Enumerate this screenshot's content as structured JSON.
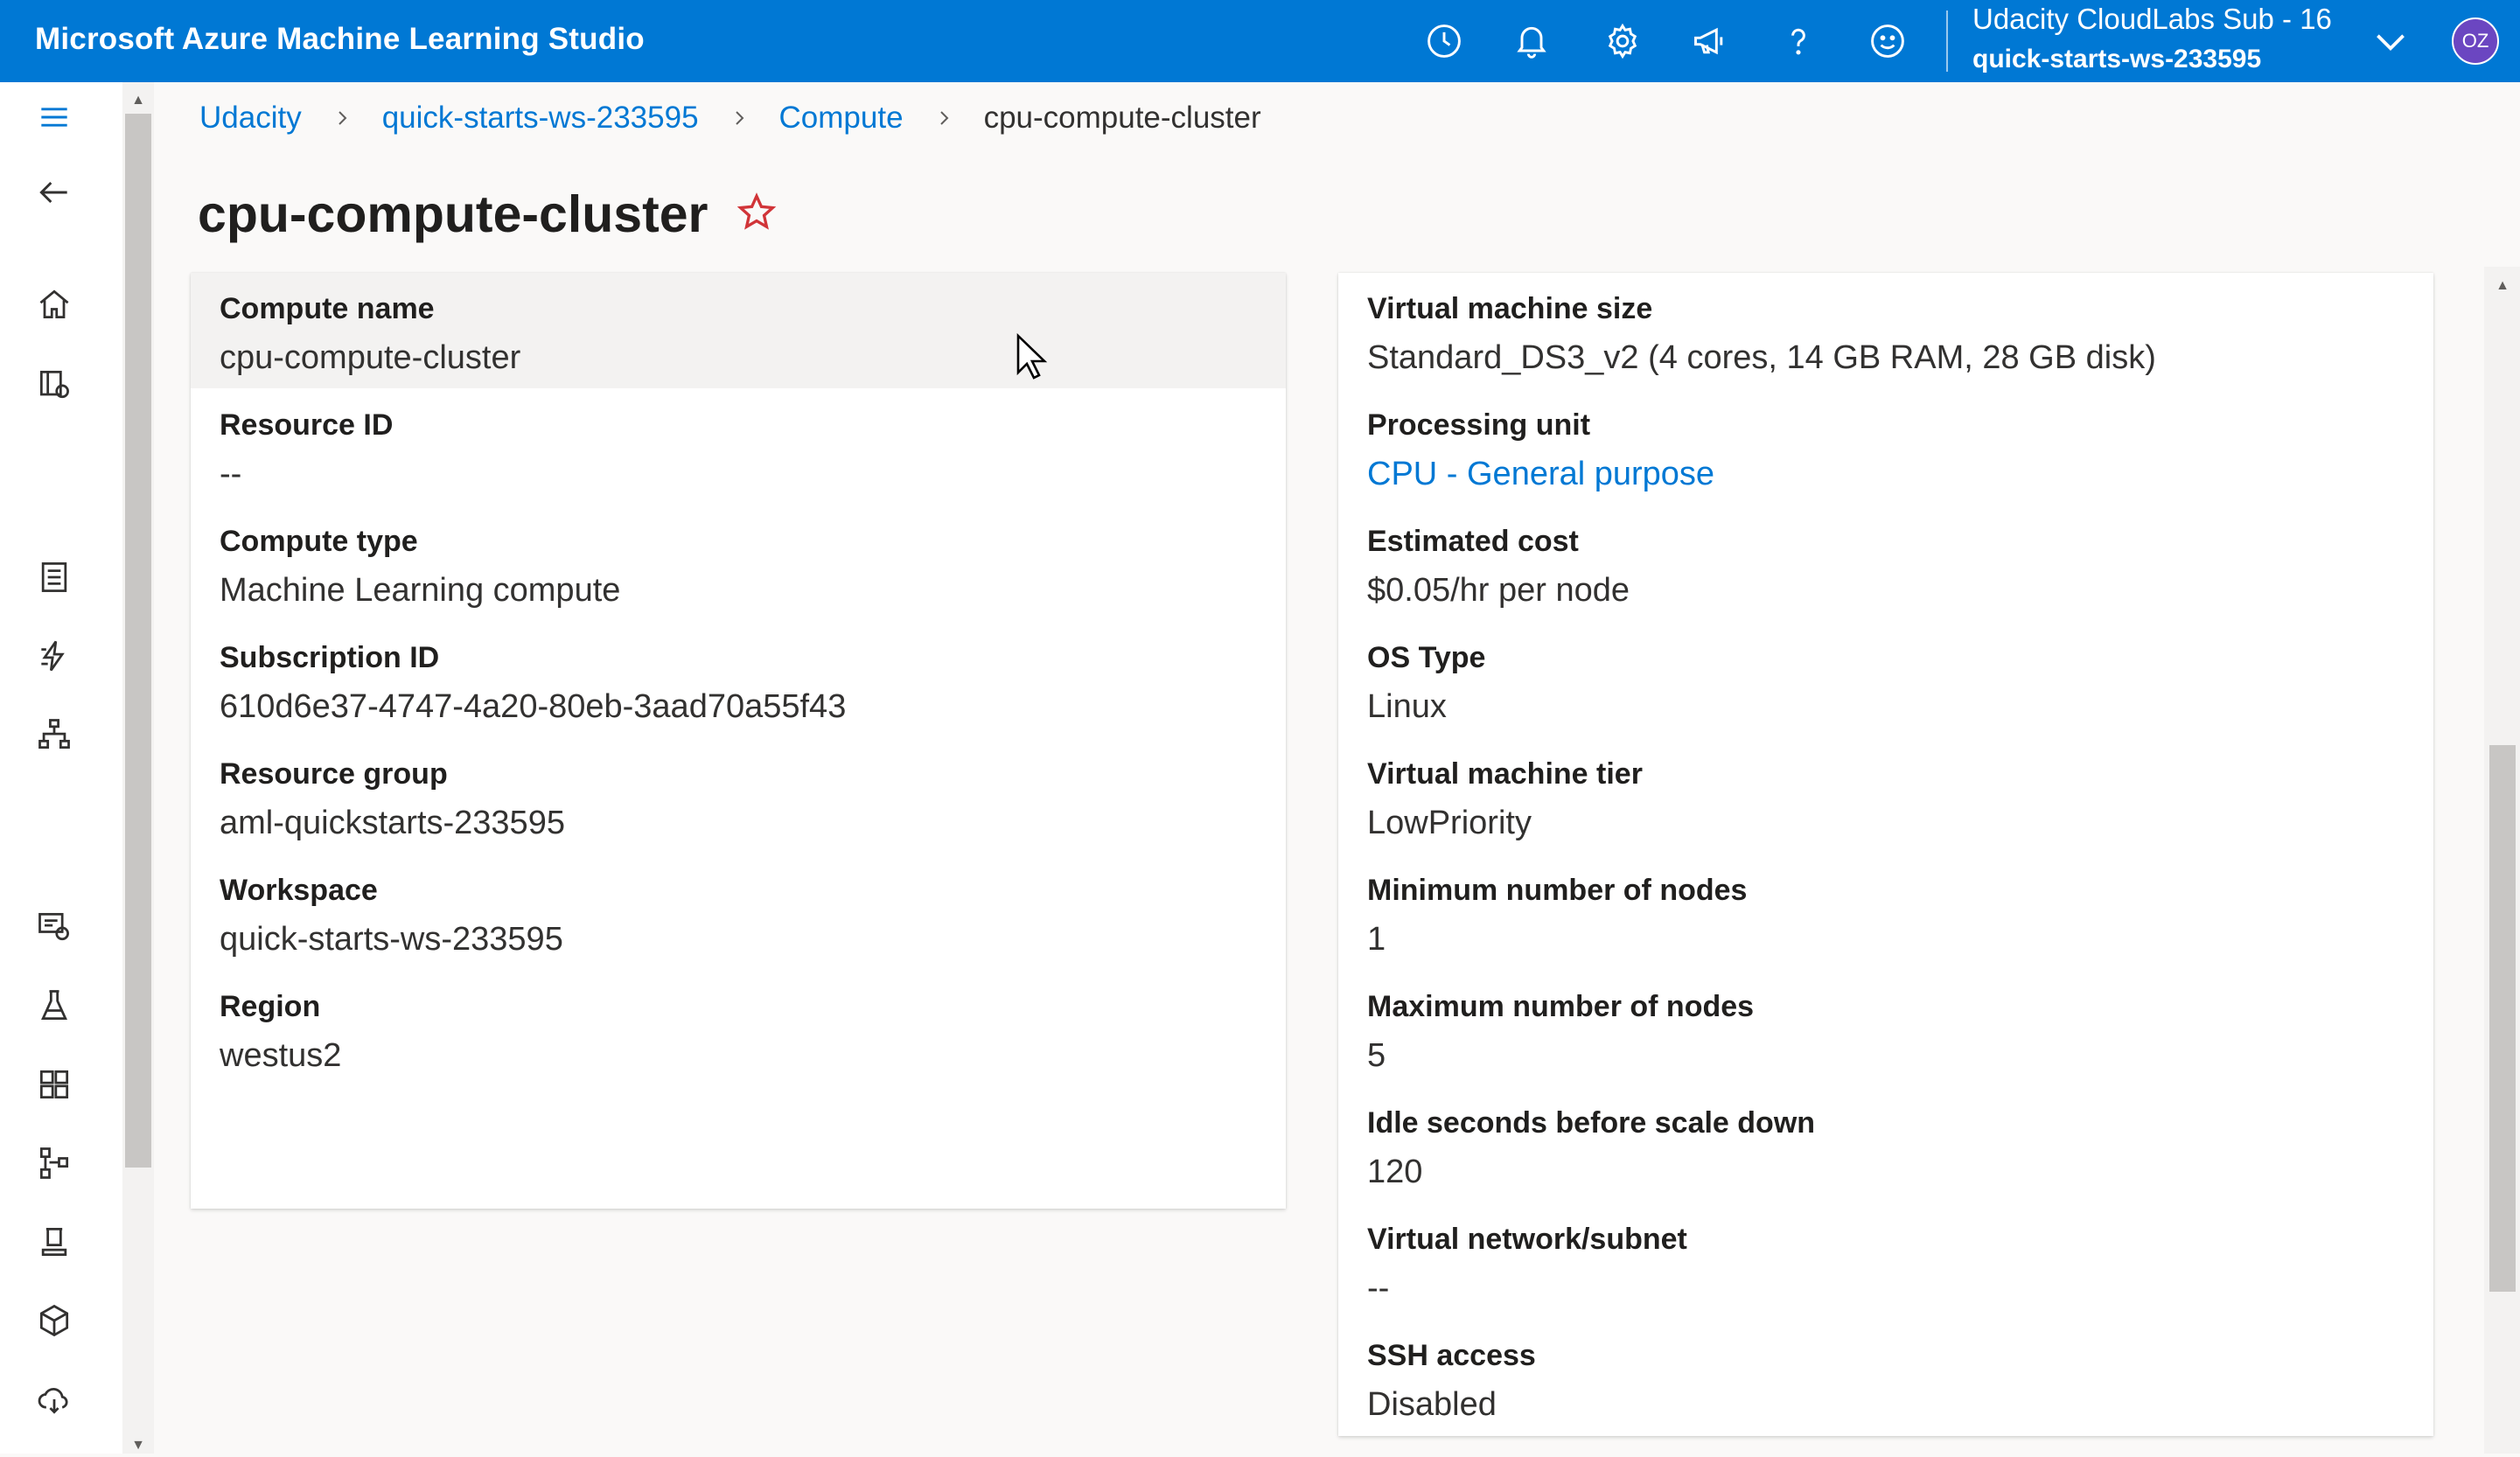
{
  "app": {
    "title": "Microsoft Azure Machine Learning Studio"
  },
  "header": {
    "icons": [
      "clock-icon",
      "bell-icon",
      "gear-icon",
      "megaphone-icon",
      "help-icon",
      "smiley-icon"
    ],
    "subscription": "Udacity CloudLabs Sub - 16",
    "workspace": "quick-starts-ws-233595",
    "avatar_initials": "OZ",
    "accent": "#0078d4"
  },
  "breadcrumb": {
    "items": [
      "Udacity",
      "quick-starts-ws-233595",
      "Compute"
    ],
    "current": "cpu-compute-cluster"
  },
  "page": {
    "title": "cpu-compute-cluster"
  },
  "left_card": [
    {
      "label": "Compute name",
      "value": "cpu-compute-cluster"
    },
    {
      "label": "Resource ID",
      "value": "--"
    },
    {
      "label": "Compute type",
      "value": "Machine Learning compute"
    },
    {
      "label": "Subscription ID",
      "value": "610d6e37-4747-4a20-80eb-3aad70a55f43"
    },
    {
      "label": "Resource group",
      "value": "aml-quickstarts-233595"
    },
    {
      "label": "Workspace",
      "value": "quick-starts-ws-233595"
    },
    {
      "label": "Region",
      "value": "westus2"
    }
  ],
  "right_card": [
    {
      "label": "Virtual machine size",
      "value": "Standard_DS3_v2 (4 cores, 14 GB RAM, 28 GB disk)"
    },
    {
      "label": "Processing unit",
      "value": "CPU - General purpose"
    },
    {
      "label": "Estimated cost",
      "value": "$0.05/hr per node"
    },
    {
      "label": "OS Type",
      "value": "Linux"
    },
    {
      "label": "Virtual machine tier",
      "value": "LowPriority"
    },
    {
      "label": "Minimum number of nodes",
      "value": "1"
    },
    {
      "label": "Maximum number of nodes",
      "value": "5"
    },
    {
      "label": "Idle seconds before scale down",
      "value": "120"
    },
    {
      "label": "Virtual network/subnet",
      "value": "--"
    },
    {
      "label": "SSH access",
      "value": "Disabled"
    }
  ]
}
